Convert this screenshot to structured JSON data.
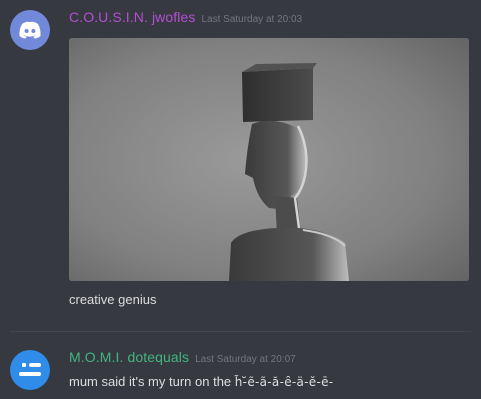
{
  "messages": [
    {
      "username": "C.O.U.S.I.N. jwofles",
      "timestamp": "Last Saturday at 20:03",
      "avatar_icon": "discord-logo-icon",
      "avatar_color": "#7289da",
      "username_color": "#b44ed6",
      "image": "photo-figure-with-box-on-head",
      "content": "creative genius"
    },
    {
      "username": "M.O.M.I. dotequals",
      "timestamp": "Last Saturday at 20:07",
      "avatar_icon": "toggle-lines-icon",
      "avatar_color": "#2f8ce8",
      "username_color": "#43b581",
      "content": "mum said it's my turn on the",
      "content_zalgo": "h̃-̆ẽ-ã-ă-ȇ-ä-ĕ-ē-"
    }
  ]
}
